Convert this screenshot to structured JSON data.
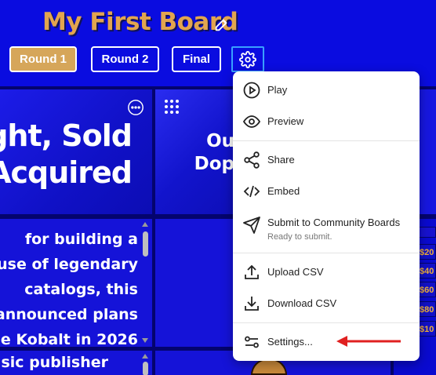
{
  "header": {
    "title": "My First Board",
    "tabs": [
      {
        "label": "Round 1",
        "active": true
      },
      {
        "label": "Round 2",
        "active": false
      },
      {
        "label": "Final",
        "active": false
      }
    ]
  },
  "board": {
    "tile1_line1": "ght, Sold",
    "tile1_line2": "Acquired",
    "tile2_line1": "Ou",
    "tile2_line2": "Dop",
    "tile3_lines": [
      "for building a",
      "use of legendary",
      "catalogs, this",
      "announced plans",
      "e Kobalt in 2026"
    ],
    "tile4_line": "usic publisher",
    "mini_values": [
      "$20",
      "$40",
      "$60",
      "$80",
      "$10"
    ]
  },
  "menu": {
    "play": "Play",
    "preview": "Preview",
    "share": "Share",
    "embed": "Embed",
    "submit": "Submit to Community Boards",
    "submit_status": "Ready to submit.",
    "upload": "Upload CSV",
    "download": "Download CSV",
    "settings": "Settings..."
  },
  "colors": {
    "board_blue": "#0a0ce0",
    "title_gold": "#e2a54f",
    "active_tab": "#d6a65a",
    "annotation_red": "#e02020"
  }
}
